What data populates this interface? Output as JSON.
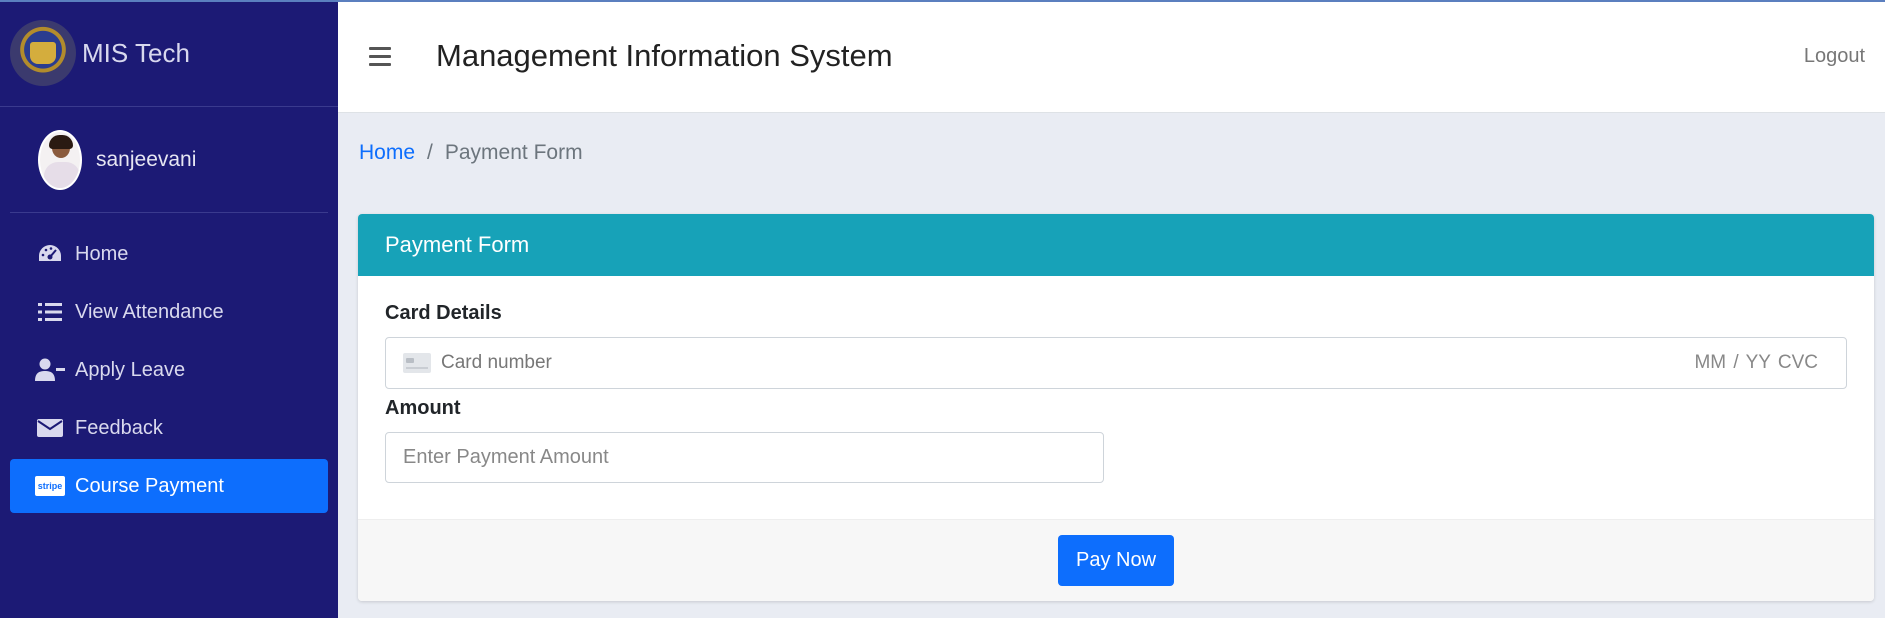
{
  "app": {
    "brand": "MIS Tech"
  },
  "user": {
    "name": "sanjeevani"
  },
  "sidebar": {
    "items": [
      {
        "label": "Home",
        "icon": "dashboard-gauge-icon"
      },
      {
        "label": "View Attendance",
        "icon": "list-icon"
      },
      {
        "label": "Apply Leave",
        "icon": "user-minus-icon"
      },
      {
        "label": "Feedback",
        "icon": "envelope-icon"
      },
      {
        "label": "Course Payment",
        "icon": "stripe-icon",
        "badge": "stripe",
        "active": true
      }
    ]
  },
  "header": {
    "title": "Management Information System",
    "logout": "Logout"
  },
  "breadcrumb": {
    "home": "Home",
    "separator": "/",
    "current": "Payment Form"
  },
  "form": {
    "title": "Payment Form",
    "card_label": "Card Details",
    "card_placeholder": "Card number",
    "card_right": "MM / YY  CVC",
    "amount_label": "Amount",
    "amount_placeholder": "Enter Payment Amount",
    "amount_value": "",
    "submit": "Pay Now"
  },
  "colors": {
    "sidebar_bg": "#1c1a75",
    "active_item": "#0d6efd",
    "card_header": "#17a2b8",
    "button": "#0d6efd"
  }
}
